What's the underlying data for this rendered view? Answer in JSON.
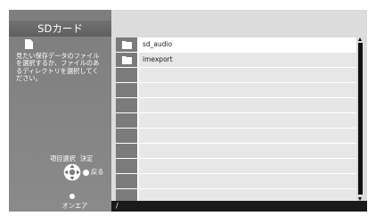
{
  "title": "SDカード",
  "help_text": "見たい保存データのファイルを選択するか、ファイルのあるディレクトリを選択してください。",
  "hints": {
    "select_label": "項目選択",
    "ok_label": "決定",
    "back_label": "戻る",
    "onair_label": "オンエア"
  },
  "files": [
    {
      "name": "sd_audio",
      "icon": "folder-icon",
      "selected": true
    },
    {
      "name": "imexport",
      "icon": "folder-icon",
      "selected": false
    },
    {
      "name": ""
    },
    {
      "name": ""
    },
    {
      "name": ""
    },
    {
      "name": ""
    },
    {
      "name": ""
    },
    {
      "name": ""
    },
    {
      "name": ""
    },
    {
      "name": ""
    },
    {
      "name": ""
    }
  ],
  "path": "/",
  "colors": {
    "left_panel": "#858585",
    "title_bar": "#686868",
    "right_panel": "#dcdcdc",
    "row_icon_cell": "#7b7b7b",
    "row_name_cell": "#e7e7e7",
    "path_bar": "#1a1a1a"
  }
}
